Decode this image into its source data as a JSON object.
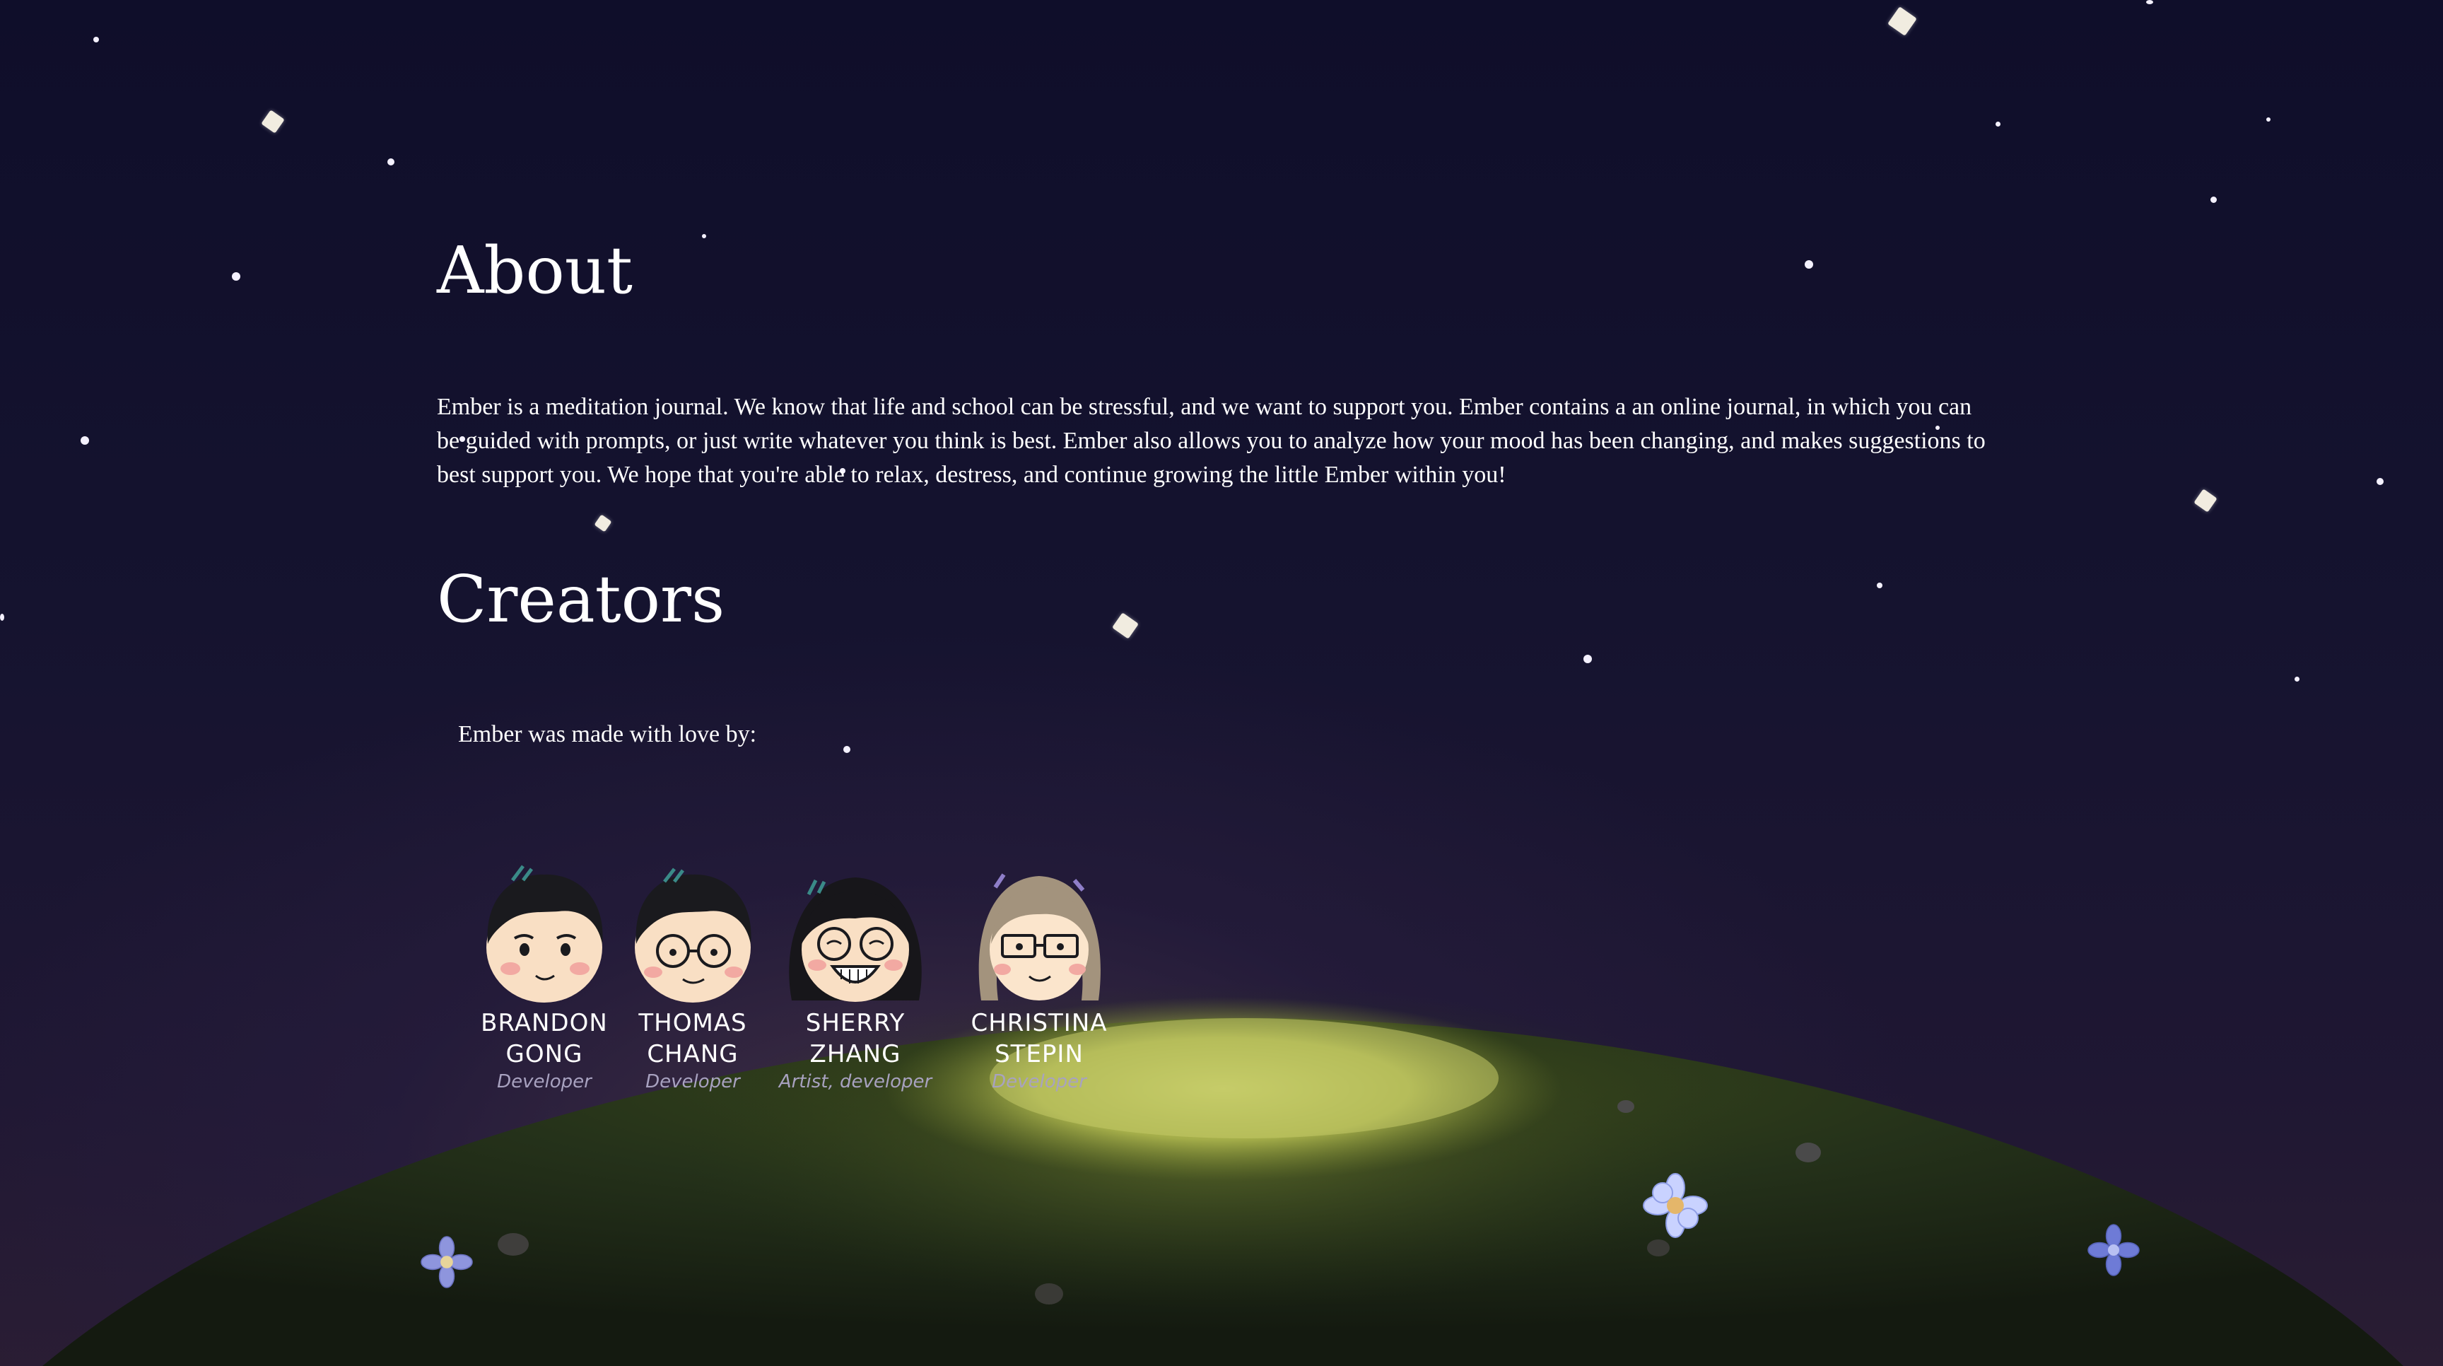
{
  "about": {
    "title": "About",
    "body": "Ember is a meditation journal. We know that life and school can be stressful, and we want to support you. Ember contains a an online journal, in which you can be guided with prompts, or just write whatever you think is best. Ember also allows you to analyze how your mood has been changing, and makes suggestions to best support you. We hope that you're able to relax, destress, and continue growing the little Ember within you!"
  },
  "creators": {
    "title": "Creators",
    "intro": "Ember was made with love by:",
    "people": [
      {
        "name": "BRANDON\nGONG",
        "role": "Developer"
      },
      {
        "name": "THOMAS\nCHANG",
        "role": "Developer"
      },
      {
        "name": "SHERRY\nZHANG",
        "role": "Artist, developer"
      },
      {
        "name": "CHRISTINA\nSTEPIN",
        "role": "Developer"
      }
    ]
  },
  "colors": {
    "sky": "#13102b",
    "hill": "#1f2a14",
    "glow": "#b8c256",
    "text": "#ffffff"
  }
}
